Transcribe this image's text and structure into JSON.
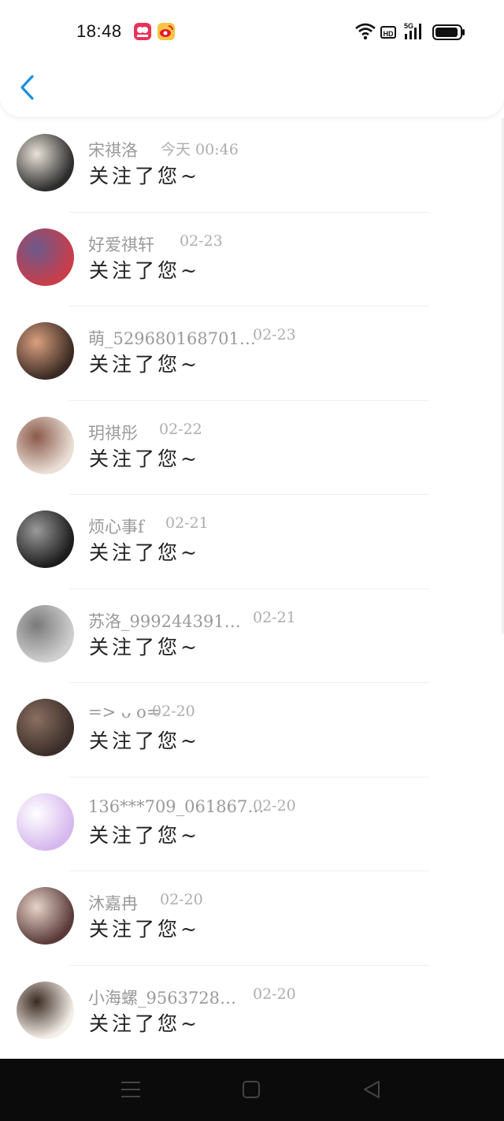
{
  "status_bar": {
    "time": "18:48",
    "network": "5G",
    "hd_label": "HD"
  },
  "header": {
    "back_icon": "chevron-left-icon"
  },
  "notifications": [
    {
      "name": "宋祺洛",
      "date": "今天 00:46",
      "message": "关注了您~",
      "avatar_colors": [
        "#2c2c2c",
        "#e9e2d8"
      ]
    },
    {
      "name": "好爱祺轩",
      "date": "02-23",
      "message": "关注了您~",
      "avatar_colors": [
        "#c93d4a",
        "#6b5a8c"
      ]
    },
    {
      "name": "萌_529680168701…",
      "date": "02-23",
      "message": "关注了您~",
      "avatar_colors": [
        "#3a2a22",
        "#d9a080"
      ]
    },
    {
      "name": "玥祺彤",
      "date": "02-22",
      "message": "关注了您~",
      "avatar_colors": [
        "#eadfd6",
        "#8b5a4a"
      ]
    },
    {
      "name": "烦心事f",
      "date": "02-21",
      "message": "关注了您~",
      "avatar_colors": [
        "#1c1c1c",
        "#9a9a9a"
      ]
    },
    {
      "name": "苏洛_999244391…",
      "date": "02-21",
      "message": "关注了您~",
      "avatar_colors": [
        "#cfcfcf",
        "#7a7a7a"
      ]
    },
    {
      "name": "=> ᴗ o=",
      "date": "02-20",
      "message": "关注了您~",
      "avatar_colors": [
        "#3b2e2a",
        "#8a6f60"
      ]
    },
    {
      "name": "136***709_061867…",
      "date": "02-20",
      "message": "关注了您~",
      "avatar_colors": [
        "#d6b8ee",
        "#ffffff"
      ]
    },
    {
      "name": "沐嘉冉",
      "date": "02-20",
      "message": "关注了您~",
      "avatar_colors": [
        "#5a3a3a",
        "#e7d3c8"
      ]
    },
    {
      "name": "小海螺_9563728…",
      "date": "02-20",
      "message": "关注了您~",
      "avatar_colors": [
        "#f4eee8",
        "#3a2a20"
      ]
    }
  ],
  "nav_bar": {
    "menu_icon": "menu-icon",
    "home_icon": "home-square-icon",
    "back_icon": "back-triangle-icon"
  },
  "colors": {
    "accent": "#1a8fe0",
    "nav_background": "#0b0b0b"
  }
}
